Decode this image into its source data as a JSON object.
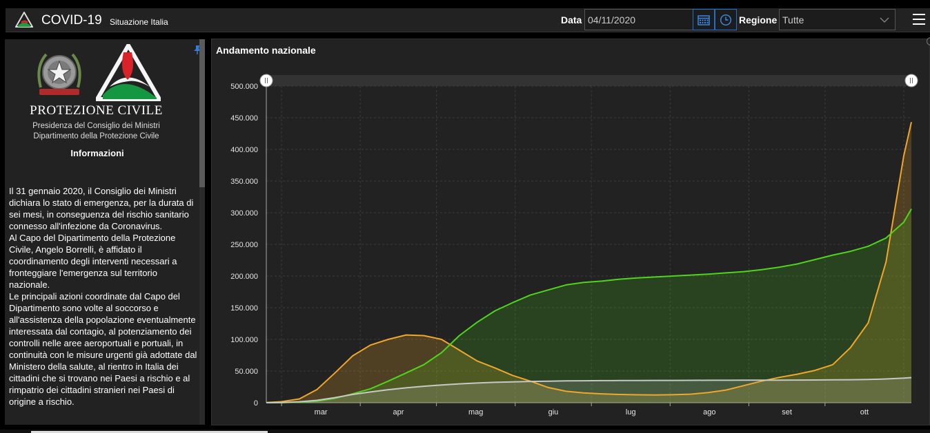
{
  "header": {
    "title": "COVID-19",
    "subtitle": "Situazione Italia",
    "data_label": "Data",
    "date_value": "04/11/2020",
    "regione_label": "Regione",
    "regione_value": "Tutte"
  },
  "sidebar": {
    "org_name": "PROTEZIONE CIVILE",
    "org_line1": "Presidenza del Consiglio dei Ministri",
    "org_line2": "Dipartimento della Protezione Civile",
    "info_heading": "Informazioni",
    "paragraphs": [
      "Il 31 gennaio 2020, il Consiglio dei Ministri dichiara lo stato di emergenza, per la durata di sei mesi, in conseguenza del rischio sanitario connesso all'infezione da Coronavirus.",
      "Al Capo del Dipartimento della Protezione Civile, Angelo Borrelli, è affidato il coordinamento degli interventi necessari a fronteggiare l'emergenza sul territorio nazionale.",
      "Le principali azioni coordinate dal Capo del Dipartimento sono volte al soccorso e all'assistenza della popolazione eventualmente interessata dal contagio, al potenziamento dei controlli nelle aree aeroportuali e portuali, in continuità con le misure urgenti già adottate dal Ministero della salute, al rientro in Italia dei cittadini che si trovano nei Paesi a rischio e al rimpatrio dei cittadini stranieri nei Paesi di origine a rischio."
    ]
  },
  "chart_title": "Andamento nazionale",
  "colors": {
    "orange": "#f0a72a",
    "green": "#4ed61c",
    "gray": "#c8c8c8",
    "accent_blue": "#1e6fd0"
  },
  "chart_data": {
    "type": "area",
    "title": "",
    "xlabel": "",
    "ylabel": "",
    "ylim": [
      0,
      500000
    ],
    "y_ticks": [
      0,
      50000,
      100000,
      150000,
      200000,
      250000,
      300000,
      350000,
      400000,
      450000,
      500000
    ],
    "y_tick_labels": [
      "0",
      "50.000",
      "100.000",
      "150.000",
      "200.000",
      "250.000",
      "300.000",
      "350.000",
      "400.000",
      "450.000",
      "500.000"
    ],
    "x_range": [
      "2020-02-24",
      "2020-11-04"
    ],
    "x_ticks": [
      "2020-03-01",
      "2020-04-01",
      "2020-05-01",
      "2020-06-01",
      "2020-07-01",
      "2020-08-01",
      "2020-09-01",
      "2020-10-01"
    ],
    "x_tick_labels": [
      "mar",
      "apr",
      "mag",
      "giu",
      "lug",
      "ago",
      "set",
      "ott"
    ],
    "grid": true,
    "series": [
      {
        "color": "#f0a72a",
        "points": [
          [
            "2020-02-24",
            200
          ],
          [
            "2020-03-01",
            1600
          ],
          [
            "2020-03-08",
            6000
          ],
          [
            "2020-03-15",
            21000
          ],
          [
            "2020-03-22",
            47000
          ],
          [
            "2020-03-29",
            74000
          ],
          [
            "2020-04-05",
            91000
          ],
          [
            "2020-04-12",
            100000
          ],
          [
            "2020-04-19",
            107000
          ],
          [
            "2020-04-26",
            106000
          ],
          [
            "2020-05-03",
            100000
          ],
          [
            "2020-05-10",
            83000
          ],
          [
            "2020-05-17",
            66000
          ],
          [
            "2020-05-24",
            55000
          ],
          [
            "2020-05-31",
            43000
          ],
          [
            "2020-06-07",
            34000
          ],
          [
            "2020-06-14",
            24000
          ],
          [
            "2020-06-21",
            18000
          ],
          [
            "2020-06-28",
            15500
          ],
          [
            "2020-07-05",
            14000
          ],
          [
            "2020-07-12",
            13000
          ],
          [
            "2020-07-19",
            12500
          ],
          [
            "2020-07-26",
            12300
          ],
          [
            "2020-08-02",
            12600
          ],
          [
            "2020-08-09",
            13500
          ],
          [
            "2020-08-16",
            16000
          ],
          [
            "2020-08-23",
            20000
          ],
          [
            "2020-08-30",
            27000
          ],
          [
            "2020-09-06",
            34000
          ],
          [
            "2020-09-13",
            40000
          ],
          [
            "2020-09-20",
            45000
          ],
          [
            "2020-09-27",
            51000
          ],
          [
            "2020-10-04",
            60000
          ],
          [
            "2020-10-11",
            87000
          ],
          [
            "2020-10-18",
            126000
          ],
          [
            "2020-10-25",
            222000
          ],
          [
            "2020-11-01",
            390000
          ],
          [
            "2020-11-04",
            443000
          ]
        ]
      },
      {
        "color": "#4ed61c",
        "points": [
          [
            "2020-02-24",
            0
          ],
          [
            "2020-03-01",
            100
          ],
          [
            "2020-03-08",
            800
          ],
          [
            "2020-03-15",
            2500
          ],
          [
            "2020-03-22",
            7000
          ],
          [
            "2020-03-29",
            14000
          ],
          [
            "2020-04-05",
            22000
          ],
          [
            "2020-04-12",
            34000
          ],
          [
            "2020-04-19",
            47000
          ],
          [
            "2020-04-26",
            60000
          ],
          [
            "2020-05-03",
            79000
          ],
          [
            "2020-05-10",
            106000
          ],
          [
            "2020-05-17",
            127000
          ],
          [
            "2020-05-24",
            145000
          ],
          [
            "2020-05-31",
            158000
          ],
          [
            "2020-06-07",
            170000
          ],
          [
            "2020-06-14",
            178000
          ],
          [
            "2020-06-21",
            186000
          ],
          [
            "2020-06-28",
            190000
          ],
          [
            "2020-07-05",
            192000
          ],
          [
            "2020-07-12",
            195000
          ],
          [
            "2020-07-19",
            197000
          ],
          [
            "2020-07-26",
            198500
          ],
          [
            "2020-08-02",
            200000
          ],
          [
            "2020-08-09",
            201500
          ],
          [
            "2020-08-16",
            203000
          ],
          [
            "2020-08-23",
            205000
          ],
          [
            "2020-08-30",
            207000
          ],
          [
            "2020-09-06",
            210000
          ],
          [
            "2020-09-13",
            214000
          ],
          [
            "2020-09-20",
            219000
          ],
          [
            "2020-09-27",
            226000
          ],
          [
            "2020-10-04",
            233000
          ],
          [
            "2020-10-11",
            239000
          ],
          [
            "2020-10-18",
            247000
          ],
          [
            "2020-10-25",
            260000
          ],
          [
            "2020-11-01",
            285000
          ],
          [
            "2020-11-04",
            306000
          ]
        ]
      },
      {
        "color": "#c8c8c8",
        "points": [
          [
            "2020-02-24",
            0
          ],
          [
            "2020-03-01",
            300
          ],
          [
            "2020-03-08",
            1500
          ],
          [
            "2020-03-15",
            3800
          ],
          [
            "2020-03-22",
            8000
          ],
          [
            "2020-03-29",
            13000
          ],
          [
            "2020-04-05",
            17000
          ],
          [
            "2020-04-12",
            20500
          ],
          [
            "2020-04-19",
            23500
          ],
          [
            "2020-04-26",
            26000
          ],
          [
            "2020-05-03",
            28000
          ],
          [
            "2020-05-10",
            29800
          ],
          [
            "2020-05-17",
            31100
          ],
          [
            "2020-05-24",
            32200
          ],
          [
            "2020-05-31",
            32900
          ],
          [
            "2020-06-07",
            33600
          ],
          [
            "2020-06-14",
            34000
          ],
          [
            "2020-06-21",
            34500
          ],
          [
            "2020-06-28",
            34700
          ],
          [
            "2020-07-05",
            34900
          ],
          [
            "2020-07-12",
            35000
          ],
          [
            "2020-07-19",
            35100
          ],
          [
            "2020-07-26",
            35200
          ],
          [
            "2020-08-02",
            35200
          ],
          [
            "2020-08-09",
            35300
          ],
          [
            "2020-08-16",
            35400
          ],
          [
            "2020-08-23",
            35400
          ],
          [
            "2020-08-30",
            35500
          ],
          [
            "2020-09-06",
            35600
          ],
          [
            "2020-09-13",
            35700
          ],
          [
            "2020-09-20",
            35800
          ],
          [
            "2020-09-27",
            35900
          ],
          [
            "2020-10-04",
            36100
          ],
          [
            "2020-10-11",
            36300
          ],
          [
            "2020-10-18",
            36600
          ],
          [
            "2020-10-25",
            37500
          ],
          [
            "2020-11-01",
            38800
          ],
          [
            "2020-11-04",
            39700
          ]
        ]
      }
    ]
  }
}
